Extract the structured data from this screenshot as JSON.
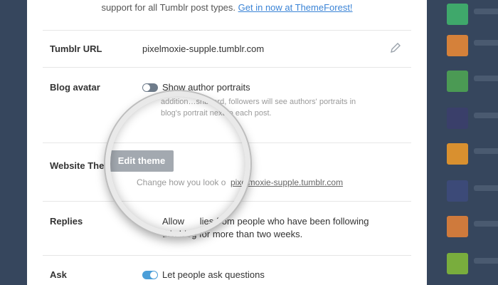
{
  "promo": {
    "text": "support for all Tumblr post types.",
    "link": "Get in now at ThemeForest!"
  },
  "settings": {
    "tumblr_url": {
      "label": "Tumblr URL",
      "value": "pixelmoxie-supple.tumblr.com"
    },
    "blog_avatar": {
      "label": "Blog avatar",
      "toggle_label": "Show author portraits",
      "enabled": false,
      "description_line1": "addition…shboard, followers will see authors' portraits in",
      "description_line2": "blog's portrait next to each post."
    },
    "website_theme": {
      "label": "Website The",
      "button": "Edit theme",
      "description": "Change how you look o",
      "link": "pixelmoxie-supple.tumblr.com"
    },
    "replies": {
      "label": "Replies",
      "line1": "Allow      lies from people who have been following",
      "line2": "this blog for more than two weeks."
    },
    "ask": {
      "label": "Ask",
      "toggle_label": "Let people ask questions",
      "enabled": true
    }
  },
  "colors": {
    "page_bg": "#36465d",
    "panel_bg": "#ffffff",
    "link": "#3b84d6",
    "toggle_on": "#4b9ed8",
    "toggle_off": "#6f7c8b",
    "button_bg": "#a3a9b0"
  },
  "icons": {
    "edit": "pencil-icon"
  }
}
